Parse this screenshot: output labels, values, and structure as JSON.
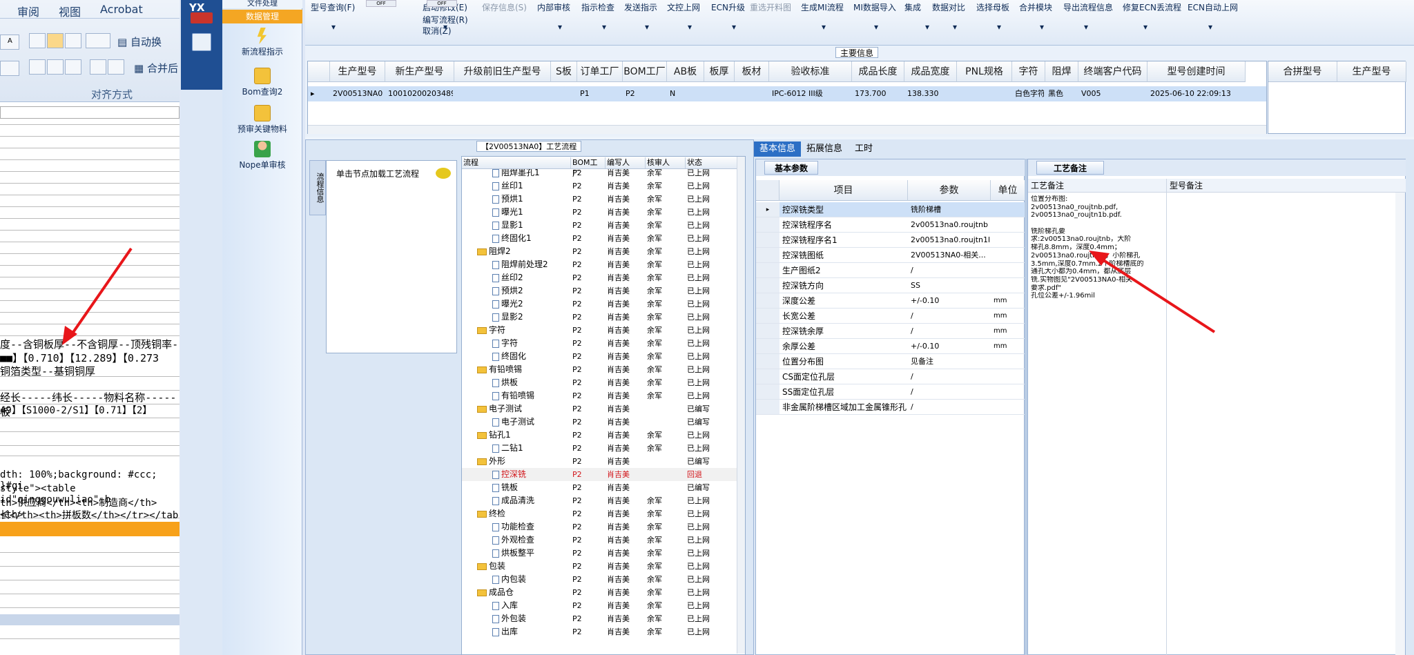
{
  "doc": {
    "tabs": [
      "审阅",
      "视图",
      "Acrobat"
    ],
    "ribbon_btns": {
      "wrap": "自动换",
      "merge": "合并后"
    },
    "align_group": "对齐方式",
    "lines": [
      "度--含铜板厚--不含铜厚--顶残铜率-",
      "■■】【0.710】【12.289】【0.273",
      "铜箔类型--基铜铜厚",
      "经长-----纬长-----物料名称-----板",
      "49】【S1000-2/S1】【0.71】【2】",
      "dth: 100%;background: #ccc; }#qi",
      "style\"><table id\"qinggouwuliao\" b",
      "th>供应商</th><th>制造商</th><th>",
      "长</th><th>拼板数</th></tr></tab"
    ]
  },
  "nav": {
    "logo": "YX",
    "top_items": [
      "文件处理",
      "数据管理"
    ],
    "items": [
      "新流程指示",
      "Bom查询2",
      "预审关键物料",
      "Nope单审核"
    ]
  },
  "toolbar": {
    "items": [
      "型号查询(F)",
      "编写流程(R)",
      "启动修改(E)",
      "保存信息(S)",
      "内部审核",
      "指示检查",
      "发送指示",
      "文控上网",
      "ECN升级",
      "重选开料图",
      "生成MI流程",
      "MI数据导入",
      "集成",
      "数据对比",
      "选择母板",
      "合并模块",
      "导出流程信息",
      "修复ECN丢流程",
      "ECN自动上网"
    ],
    "cancel": "取消(Z)",
    "off1": "OFF",
    "off2": "OFF"
  },
  "main_info": {
    "title": "主要信息",
    "headers": [
      "生产型号",
      "新生产型号",
      "升级前旧生产型号",
      "S板",
      "订单工厂",
      "BOM工厂",
      "AB板",
      "板厚",
      "板材",
      "验收标准",
      "成品长度",
      "成品宽度",
      "PNL规格",
      "字符",
      "阻焊",
      "终端客户代码",
      "型号创建时间"
    ],
    "row": [
      "2V00513NA0",
      "10010200203489",
      "",
      "",
      "P1",
      "P2",
      "N",
      "",
      "",
      "IPC-6012 III级",
      "173.700",
      "138.330",
      "",
      "白色字符",
      "黑色",
      "V005",
      "2025-06-10 22:09:13"
    ],
    "right_headers": [
      "合拼型号",
      "生产型号"
    ]
  },
  "flow": {
    "title": "【2V00513NA0】工艺流程",
    "left_text": "单击节点加载工艺流程",
    "side_tab": "流程信息",
    "headers": [
      "流程",
      "BOM工厂",
      "编写人",
      "核审人",
      "状态"
    ],
    "rows": [
      {
        "lv": 2,
        "t": "阻焊墨孔1",
        "f": "P2",
        "w": "肖吉美",
        "c": "余军",
        "s": "已上网"
      },
      {
        "lv": 2,
        "t": "丝印1",
        "f": "P2",
        "w": "肖吉美",
        "c": "余军",
        "s": "已上网"
      },
      {
        "lv": 2,
        "t": "预烘1",
        "f": "P2",
        "w": "肖吉美",
        "c": "余军",
        "s": "已上网"
      },
      {
        "lv": 2,
        "t": "曝光1",
        "f": "P2",
        "w": "肖吉美",
        "c": "余军",
        "s": "已上网"
      },
      {
        "lv": 2,
        "t": "显影1",
        "f": "P2",
        "w": "肖吉美",
        "c": "余军",
        "s": "已上网"
      },
      {
        "lv": 2,
        "t": "终固化1",
        "f": "P2",
        "w": "肖吉美",
        "c": "余军",
        "s": "已上网"
      },
      {
        "lv": 1,
        "t": "阻焊2",
        "f": "P2",
        "w": "肖吉美",
        "c": "余军",
        "s": "已上网"
      },
      {
        "lv": 2,
        "t": "阻焊前处理2",
        "f": "P2",
        "w": "肖吉美",
        "c": "余军",
        "s": "已上网"
      },
      {
        "lv": 2,
        "t": "丝印2",
        "f": "P2",
        "w": "肖吉美",
        "c": "余军",
        "s": "已上网"
      },
      {
        "lv": 2,
        "t": "预烘2",
        "f": "P2",
        "w": "肖吉美",
        "c": "余军",
        "s": "已上网"
      },
      {
        "lv": 2,
        "t": "曝光2",
        "f": "P2",
        "w": "肖吉美",
        "c": "余军",
        "s": "已上网"
      },
      {
        "lv": 2,
        "t": "显影2",
        "f": "P2",
        "w": "肖吉美",
        "c": "余军",
        "s": "已上网"
      },
      {
        "lv": 1,
        "t": "字符",
        "f": "P2",
        "w": "肖吉美",
        "c": "余军",
        "s": "已上网"
      },
      {
        "lv": 2,
        "t": "字符",
        "f": "P2",
        "w": "肖吉美",
        "c": "余军",
        "s": "已上网"
      },
      {
        "lv": 2,
        "t": "终固化",
        "f": "P2",
        "w": "肖吉美",
        "c": "余军",
        "s": "已上网"
      },
      {
        "lv": 1,
        "t": "有铅喷锡",
        "f": "P2",
        "w": "肖吉美",
        "c": "余军",
        "s": "已上网"
      },
      {
        "lv": 2,
        "t": "烘板",
        "f": "P2",
        "w": "肖吉美",
        "c": "余军",
        "s": "已上网"
      },
      {
        "lv": 2,
        "t": "有铅喷锡",
        "f": "P2",
        "w": "肖吉美",
        "c": "余军",
        "s": "已上网"
      },
      {
        "lv": 1,
        "t": "电子测试",
        "f": "P2",
        "w": "肖吉美",
        "c": "",
        "s": "已编写"
      },
      {
        "lv": 2,
        "t": "电子测试",
        "f": "P2",
        "w": "肖吉美",
        "c": "",
        "s": "已编写"
      },
      {
        "lv": 1,
        "t": "钻孔1",
        "f": "P2",
        "w": "肖吉美",
        "c": "余军",
        "s": "已上网"
      },
      {
        "lv": 2,
        "t": "二钻1",
        "f": "P2",
        "w": "肖吉美",
        "c": "余军",
        "s": "已上网"
      },
      {
        "lv": 1,
        "t": "外形",
        "f": "P2",
        "w": "肖吉美",
        "c": "",
        "s": "已编写"
      },
      {
        "lv": 2,
        "t": "控深铣",
        "f": "P2",
        "w": "肖吉美",
        "c": "",
        "s": "回退",
        "hl": true
      },
      {
        "lv": 2,
        "t": "铣板",
        "f": "P2",
        "w": "肖吉美",
        "c": "",
        "s": "已编写"
      },
      {
        "lv": 2,
        "t": "成品清洗",
        "f": "P2",
        "w": "肖吉美",
        "c": "余军",
        "s": "已上网"
      },
      {
        "lv": 1,
        "t": "终检",
        "f": "P2",
        "w": "肖吉美",
        "c": "余军",
        "s": "已上网"
      },
      {
        "lv": 2,
        "t": "功能检查",
        "f": "P2",
        "w": "肖吉美",
        "c": "余军",
        "s": "已上网"
      },
      {
        "lv": 2,
        "t": "外观检查",
        "f": "P2",
        "w": "肖吉美",
        "c": "余军",
        "s": "已上网"
      },
      {
        "lv": 2,
        "t": "烘板整平",
        "f": "P2",
        "w": "肖吉美",
        "c": "余军",
        "s": "已上网"
      },
      {
        "lv": 1,
        "t": "包装",
        "f": "P2",
        "w": "肖吉美",
        "c": "余军",
        "s": "已上网"
      },
      {
        "lv": 2,
        "t": "内包装",
        "f": "P2",
        "w": "肖吉美",
        "c": "余军",
        "s": "已上网"
      },
      {
        "lv": 1,
        "t": "成品仓",
        "f": "P2",
        "w": "肖吉美",
        "c": "余军",
        "s": "已上网"
      },
      {
        "lv": 2,
        "t": "入库",
        "f": "P2",
        "w": "肖吉美",
        "c": "余军",
        "s": "已上网"
      },
      {
        "lv": 2,
        "t": "外包装",
        "f": "P2",
        "w": "肖吉美",
        "c": "余军",
        "s": "已上网"
      },
      {
        "lv": 2,
        "t": "出库",
        "f": "P2",
        "w": "肖吉美",
        "c": "余军",
        "s": "已上网"
      }
    ]
  },
  "tabs": [
    "基本信息",
    "拓展信息",
    "工时"
  ],
  "params": {
    "tab": "基本参数",
    "headers": [
      "项目",
      "参数",
      "单位"
    ],
    "rows": [
      {
        "k": "控深铣类型",
        "v": "铣阶梯槽",
        "u": ""
      },
      {
        "k": "控深铣程序名",
        "v": "2v00513na0.roujtnb",
        "u": ""
      },
      {
        "k": "控深铣程序名1",
        "v": "2v00513na0.roujtn1b",
        "u": ""
      },
      {
        "k": "控深铣图纸",
        "v": "2V00513NA0-相关...",
        "u": ""
      },
      {
        "k": "生产图纸2",
        "v": "/",
        "u": ""
      },
      {
        "k": "控深铣方向",
        "v": "SS",
        "u": ""
      },
      {
        "k": "深度公差",
        "v": "+/-0.10",
        "u": "mm"
      },
      {
        "k": "长宽公差",
        "v": "/",
        "u": "mm"
      },
      {
        "k": "控深铣余厚",
        "v": "/",
        "u": "mm"
      },
      {
        "k": "余厚公差",
        "v": "+/-0.10",
        "u": "mm"
      },
      {
        "k": "位置分布图",
        "v": "见备注",
        "u": ""
      },
      {
        "k": "CS面定位孔层",
        "v": "/",
        "u": ""
      },
      {
        "k": "SS面定位孔层",
        "v": "/",
        "u": ""
      },
      {
        "k": "非金属阶梯槽区域加工金属锥形孔",
        "v": "/",
        "u": ""
      }
    ]
  },
  "notes": {
    "tab": "工艺备注",
    "headers": [
      "工艺备注",
      "型号备注"
    ],
    "lines": [
      "位置分布图:",
      "2v00513na0_roujtnb.pdf,",
      "2v00513na0_roujtn1b.pdf.",
      "",
      "铣阶梯孔要",
      "求:2v00513na0.roujtnb，大阶",
      "梯孔8.8mm，深度0.4mm；",
      "2v00513na0.roujtn1b，小阶梯孔",
      "3.5mm,深度0.7mm.2个阶梯槽底的",
      "通孔大小都为0.4mm，都从底层",
      "铣.实物图见\"2V00513NA0-相关",
      "要求.pdf\"",
      "孔位公差+/-1.96mil"
    ]
  }
}
